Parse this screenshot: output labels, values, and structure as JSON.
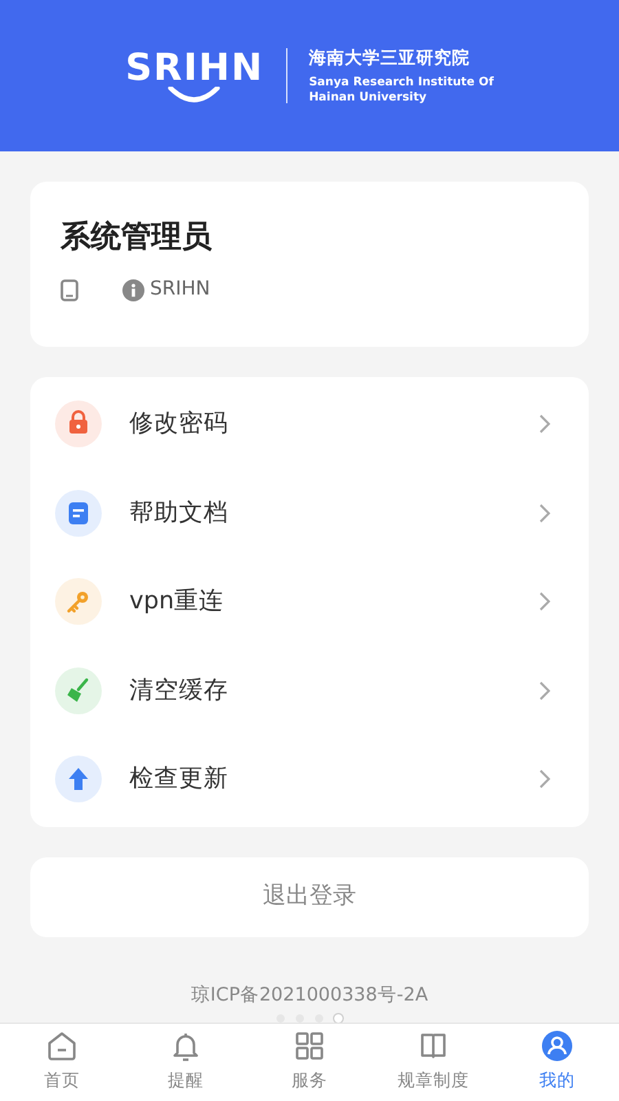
{
  "header": {
    "logo": "SRIHN",
    "org_name": "海南大学三亚研究院",
    "org_name_en_line1": "Sanya Research Institute Of",
    "org_name_en_line2": "Hainan University"
  },
  "profile": {
    "name": "系统管理员",
    "org": "SRIHN"
  },
  "menu": [
    {
      "kind": "lock",
      "label": "修改密码",
      "color": "#f0623f"
    },
    {
      "kind": "doc",
      "label": "帮助文档",
      "color": "#3d7ff2"
    },
    {
      "kind": "key",
      "label": "vpn重连",
      "color": "#f2a12a"
    },
    {
      "kind": "broom",
      "label": "清空缓存",
      "color": "#3bb54a"
    },
    {
      "kind": "upload",
      "label": "检查更新",
      "color": "#3d7ff2"
    }
  ],
  "logout": "退出登录",
  "icp": "琼ICP备2021000338号-2A",
  "pager": [
    {
      "selected": false
    },
    {
      "selected": false
    },
    {
      "selected": false
    },
    {
      "selected": true
    }
  ],
  "tabs": [
    {
      "kind": "home",
      "label": "首页",
      "selected": false
    },
    {
      "kind": "bell",
      "label": "提醒",
      "selected": false
    },
    {
      "kind": "grid",
      "label": "服务",
      "selected": false
    },
    {
      "kind": "book",
      "label": "规章制度",
      "selected": false
    },
    {
      "kind": "user",
      "label": "我的",
      "selected": true
    }
  ]
}
